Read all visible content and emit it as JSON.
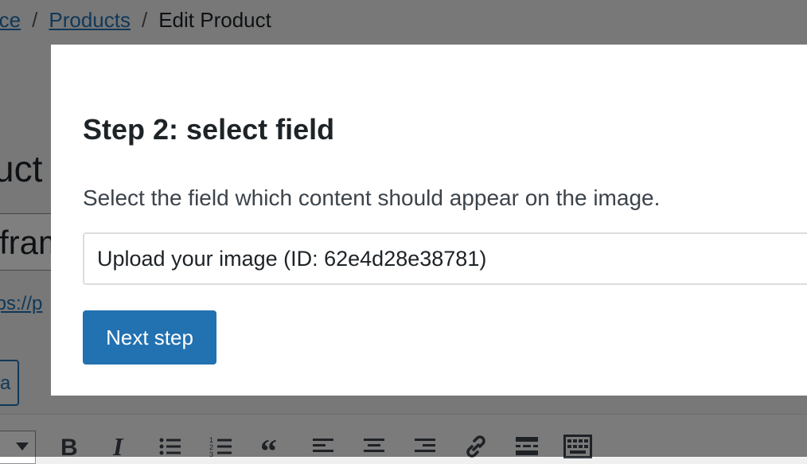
{
  "breadcrumb": {
    "items": [
      "rce",
      "Products",
      "Edit Product"
    ],
    "separator": "/"
  },
  "page": {
    "title_fragment": "uct",
    "title_input_fragment": "fram",
    "permalink_fragment": "tps://p",
    "media_button_fragment": "a"
  },
  "toolbar": {
    "icons": [
      "bold-icon",
      "italic-icon",
      "bullet-list-icon",
      "numbered-list-icon",
      "blockquote-icon",
      "align-left-icon",
      "align-center-icon",
      "align-right-icon",
      "link-icon",
      "read-more-icon",
      "toolbar-toggle-icon"
    ]
  },
  "modal": {
    "title": "Step 2: select field",
    "description": "Select the field which content should appear on the image.",
    "field_select_value": "Upload your image (ID: 62e4d28e38781)",
    "next_button_label": "Next step"
  },
  "colors": {
    "accent": "#2271b1",
    "overlay": "rgba(0,0,0,0.5)",
    "text": "#1d2327"
  }
}
